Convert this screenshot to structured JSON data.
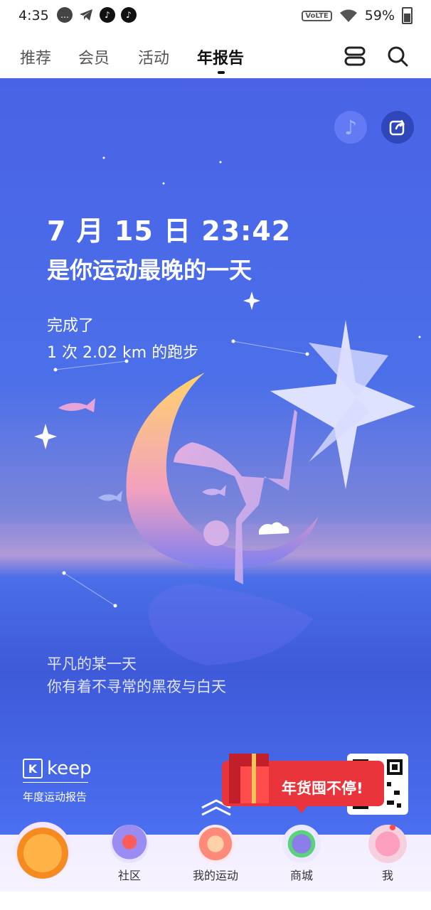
{
  "status_bar": {
    "time": "4:35",
    "network": "VoLTE",
    "battery": "59%"
  },
  "top_nav": {
    "tabs": [
      {
        "label": "推荐"
      },
      {
        "label": "会员"
      },
      {
        "label": "活动"
      },
      {
        "label": "年报告"
      }
    ],
    "active_tab": "年报告"
  },
  "hero": {
    "datetime": "7 月 15 日 23:42",
    "headline": "是你运动最晚的一天",
    "line1": "完成了",
    "line2": "1 次 2.02 km 的跑步",
    "quote1": "平凡的某一天",
    "quote2": "你有着不寻常的黑夜与白天",
    "brand": "keep",
    "brand_sub": "年度运动报告"
  },
  "promo": {
    "label": "年货囤不停!"
  },
  "bottom_nav": {
    "items": [
      {
        "label": "社区"
      },
      {
        "label": "我的运动"
      },
      {
        "label": "商城"
      },
      {
        "label": "我"
      }
    ]
  },
  "colors": {
    "hero_blue": "#4a63e6",
    "promo_red": "#e8343a",
    "accent": "#ff4b4b"
  }
}
